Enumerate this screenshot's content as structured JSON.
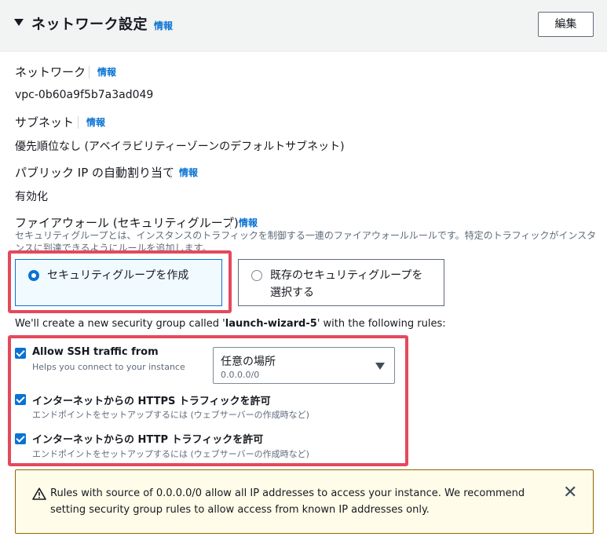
{
  "header": {
    "title": "ネットワーク設定",
    "info": "情報",
    "edit_button": "編集"
  },
  "network": {
    "label": "ネットワーク",
    "info": "情報",
    "value": "vpc-0b60a9f5b7a3ad049"
  },
  "subnet": {
    "label": "サブネット",
    "info": "情報",
    "value": "優先順位なし (アベイラビリティーゾーンのデフォルトサブネット)"
  },
  "public_ip": {
    "label": "パブリック IP の自動割り当て",
    "info": "情報",
    "value": "有効化"
  },
  "firewall": {
    "label": "ファイアウォール (セキュリティグループ)",
    "info": "情報",
    "description": "セキュリティグループとは、インスタンスのトラフィックを制御する一連のファイアウォールルールです。特定のトラフィックがインスタンスに到達できるようにルールを追加します。",
    "options": [
      {
        "label": "セキュリティグループを作成",
        "selected": true
      },
      {
        "label_line1": "既存のセキュリティグループを",
        "label_line2": "選択する",
        "selected": false
      }
    ]
  },
  "create_notice": {
    "prefix": "We'll create a new security group called '",
    "group_name": "launch-wizard-5",
    "suffix": "' with the following rules:"
  },
  "rules": [
    {
      "title": "Allow SSH traffic from",
      "description": "Helps you connect to your instance",
      "checked": true
    },
    {
      "title": "インターネットからの HTTPS トラフィックを許可",
      "description": "エンドポイントをセットアップするには (ウェブサーバーの作成時など)",
      "checked": true
    },
    {
      "title": "インターネットからの HTTP トラフィックを許可",
      "description": "エンドポイントをセットアップするには (ウェブサーバーの作成時など)",
      "checked": true
    }
  ],
  "ssh_source_select": {
    "value": "任意の場所",
    "sub": "0.0.0.0/0"
  },
  "warning": {
    "text": "Rules with source of 0.0.0.0/0 allow all IP addresses to access your instance. We recommend setting security group rules to allow access from known IP addresses only.",
    "icon": "warning-triangle-icon",
    "close_icon": "close-icon"
  },
  "colors": {
    "accent": "#0972d3",
    "highlight_box": "#e34a5c",
    "warning_bg": "#fffce9",
    "warning_border": "#8d6605"
  }
}
